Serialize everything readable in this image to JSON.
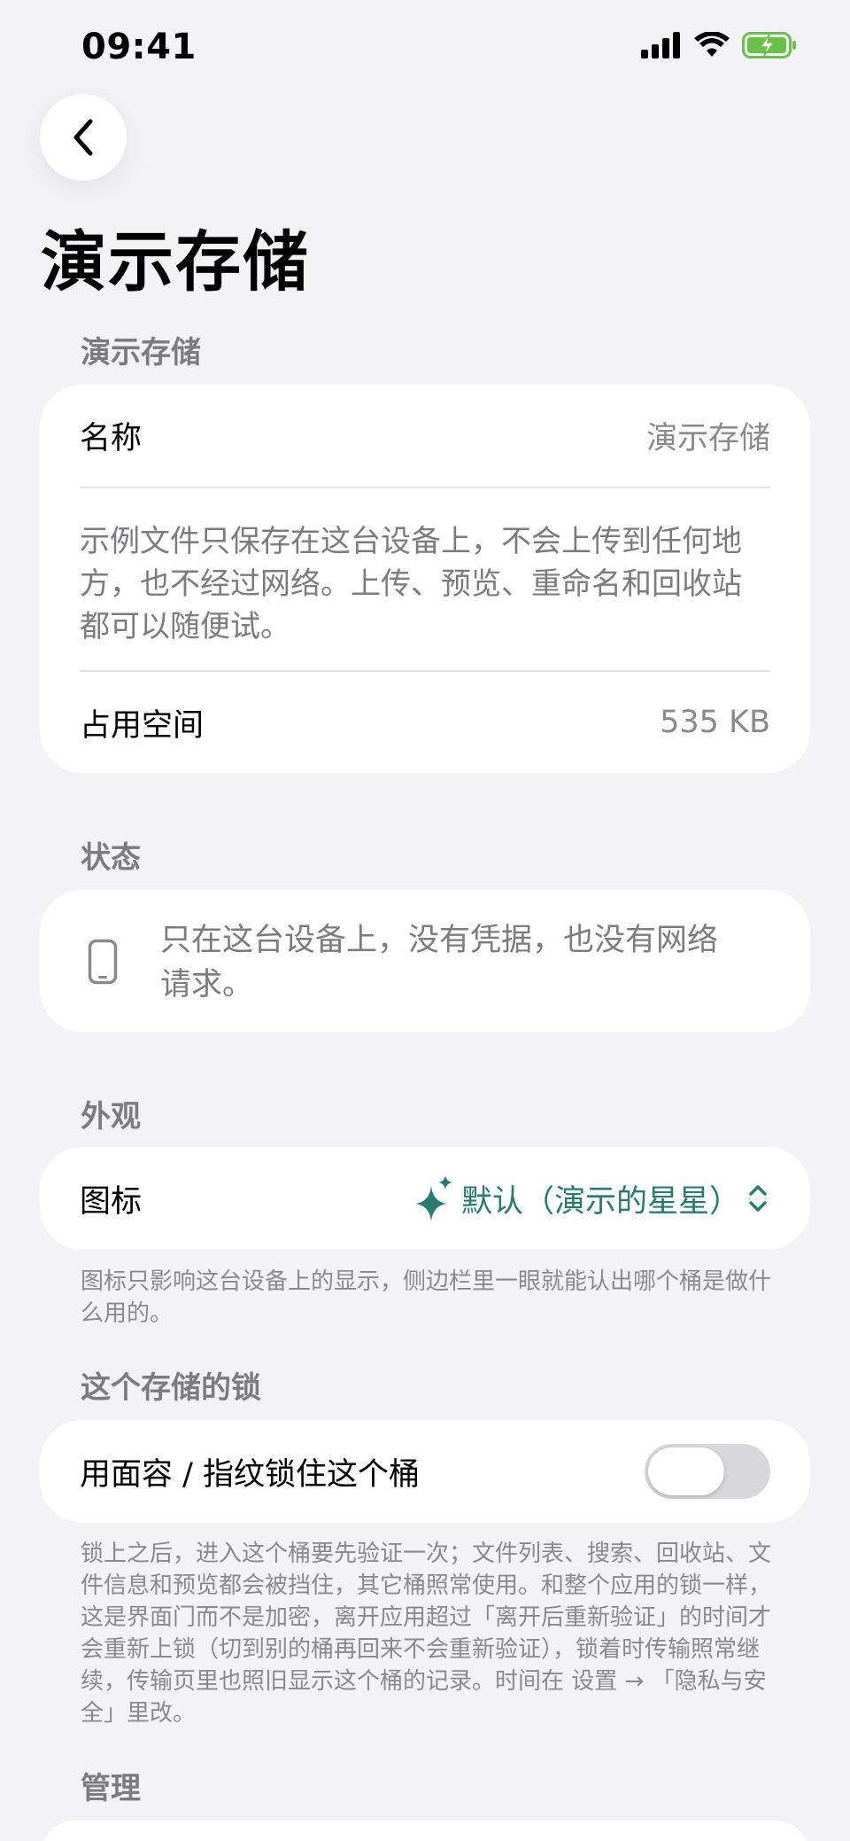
{
  "status_bar": {
    "time": "09:41"
  },
  "page": {
    "title": "演示存储"
  },
  "storage_section": {
    "header": "演示存储",
    "name_label": "名称",
    "name_value": "演示存储",
    "description": "示例文件只保存在这台设备上，不会上传到任何地方，也不经过网络。上传、预览、重命名和回收站都可以随便试。",
    "usage_label": "占用空间",
    "usage_value": "535 KB"
  },
  "status_section": {
    "header": "状态",
    "text": "只在这台设备上，没有凭据，也没有网络请求。"
  },
  "appearance_section": {
    "header": "外观",
    "icon_label": "图标",
    "icon_value": "默认（演示的星星）",
    "footnote": "图标只影响这台设备上的显示，侧边栏里一眼就能认出哪个桶是做什么用的。",
    "accent_color": "#2a7a72"
  },
  "lock_section": {
    "header": "这个存储的锁",
    "toggle_label": "用面容 / 指纹锁住这个桶",
    "toggle_on": false,
    "footnote": "锁上之后，进入这个桶要先验证一次；文件列表、搜索、回收站、文件信息和预览都会被挡住，其它桶照常使用。和整个应用的锁一样，这是界面门而不是加密，离开应用超过「离开后重新验证」的时间才会重新上锁（切到别的桶再回来不会重新验证），锁着时传输照常继续，传输页里也照旧显示这个桶的记录。时间在 设置 → 「隐私与安全」里改。"
  },
  "manage_section": {
    "header": "管理"
  }
}
